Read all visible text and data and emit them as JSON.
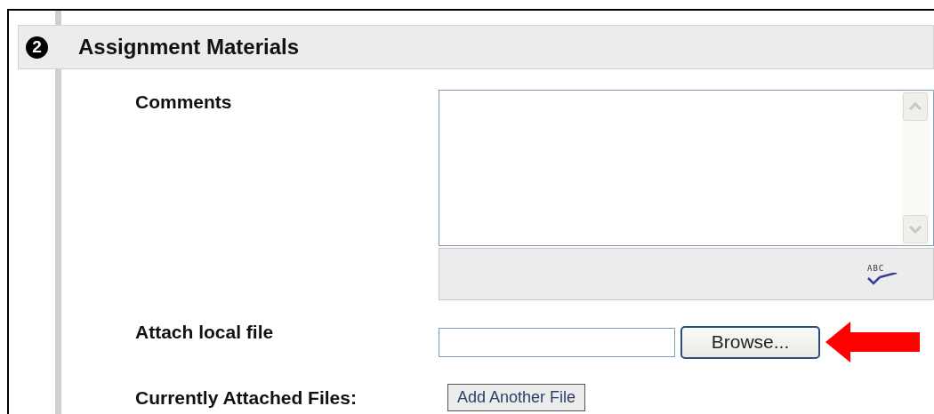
{
  "section": {
    "number": "2",
    "title": "Assignment Materials"
  },
  "comments": {
    "label": "Comments",
    "spellcheck_label": "ABC"
  },
  "attach": {
    "label": "Attach local file",
    "button": "Browse..."
  },
  "attached": {
    "label": "Currently Attached Files:",
    "button": "Add Another File"
  }
}
